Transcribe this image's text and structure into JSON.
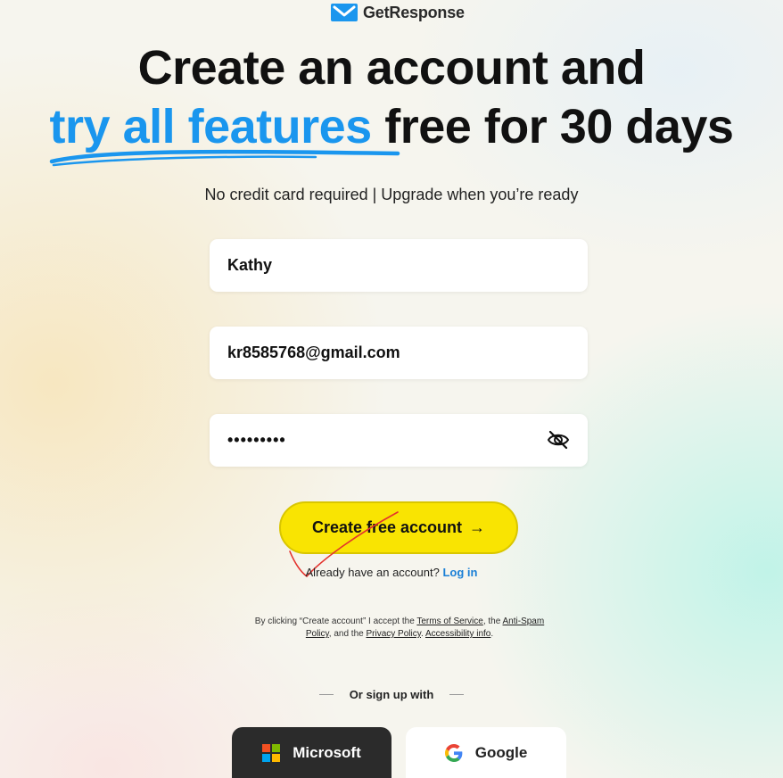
{
  "brand": {
    "name": "GetResponse",
    "color": "#1a96ee"
  },
  "headline": {
    "line1": "Create an account and",
    "accent": "try all features",
    "line2_rest": "free for 30 days"
  },
  "subline": "No credit card required | Upgrade when you’re ready",
  "form": {
    "name_value": "Kathy",
    "email_value": "kr8585768@gmail.com",
    "password_masked": "•••••••••"
  },
  "cta": {
    "label": "Create free account",
    "arrow": "→",
    "color": "#f9e402"
  },
  "login": {
    "prompt": "Already have an account?",
    "link": "Log in"
  },
  "legal": {
    "p1": "By clicking “Create account” I accept the ",
    "terms": "Terms of Service",
    "p2": ", the ",
    "anti_spam": "Anti-Spam Policy",
    "p3": ", and the ",
    "privacy": "Privacy Policy",
    "p4": ". ",
    "accessibility": "Accessibility info",
    "p5": "."
  },
  "divider_label": "Or sign up with",
  "social": {
    "microsoft": "Microsoft",
    "google": "Google"
  },
  "icons": {
    "logo": "envelope-logo-icon",
    "eye": "eye-slash-icon",
    "ms": "microsoft-logo-icon",
    "google": "google-logo-icon"
  }
}
